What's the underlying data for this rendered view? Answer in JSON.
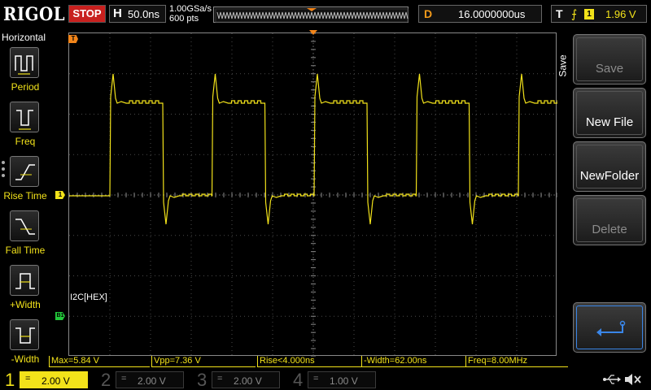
{
  "topbar": {
    "logo": "RIGOL",
    "run_state": "STOP",
    "timebase_label": "H",
    "timebase_value": "50.0ns",
    "sample_rate": "1.00GSa/s",
    "memory_depth": "600 pts",
    "delay_label": "D",
    "delay_value": "16.0000000us",
    "trigger_type": "T",
    "trigger_edge_icon": "rising-edge-icon",
    "trigger_source": "1",
    "trigger_level": "1.96 V"
  },
  "left_menu": {
    "title": "Horizontal",
    "items": [
      {
        "label": "Period",
        "icon": "period-icon"
      },
      {
        "label": "Freq",
        "icon": "freq-icon"
      },
      {
        "label": "Rise Time",
        "icon": "rise-time-icon"
      },
      {
        "label": "Fall Time",
        "icon": "fall-time-icon"
      },
      {
        "label": "+Width",
        "icon": "positive-width-icon"
      },
      {
        "label": "-Width",
        "icon": "negative-width-icon"
      }
    ]
  },
  "screen": {
    "trigger_marker": "T",
    "ch1_marker": "1",
    "bus_marker": "B1",
    "decode_label": "I2C[HEX]"
  },
  "right_menu": {
    "title": "Save",
    "buttons": [
      {
        "label": "Save",
        "enabled": false
      },
      {
        "label": "New File",
        "enabled": true
      },
      {
        "label": "NewFolder",
        "enabled": true
      },
      {
        "label": "Delete",
        "enabled": false
      }
    ],
    "return_icon": "return-arrow-icon"
  },
  "measurements": [
    "Max=5.84 V",
    "Vpp=7.36 V",
    "Rise<4.000ns",
    "-Width=62.00ns",
    "Freq=8.00MHz"
  ],
  "channels": [
    {
      "num": "1",
      "coupling": "=",
      "scale": "2.00 V",
      "color": "#f2e21a",
      "active": true
    },
    {
      "num": "2",
      "coupling": "=",
      "scale": "2.00 V",
      "color": "#16c0e0",
      "active": false
    },
    {
      "num": "3",
      "coupling": "=",
      "scale": "2.00 V",
      "color": "#e020e0",
      "active": false
    },
    {
      "num": "4",
      "coupling": "=",
      "scale": "1.00 V",
      "color": "#1a6ef0",
      "active": false
    }
  ],
  "status_icons": [
    "usb-icon",
    "mute-icon"
  ],
  "colors": {
    "ch1": "#f2e21a",
    "trigger": "#f2851a",
    "stop": "#c8201e",
    "bus": "#22c83a"
  }
}
